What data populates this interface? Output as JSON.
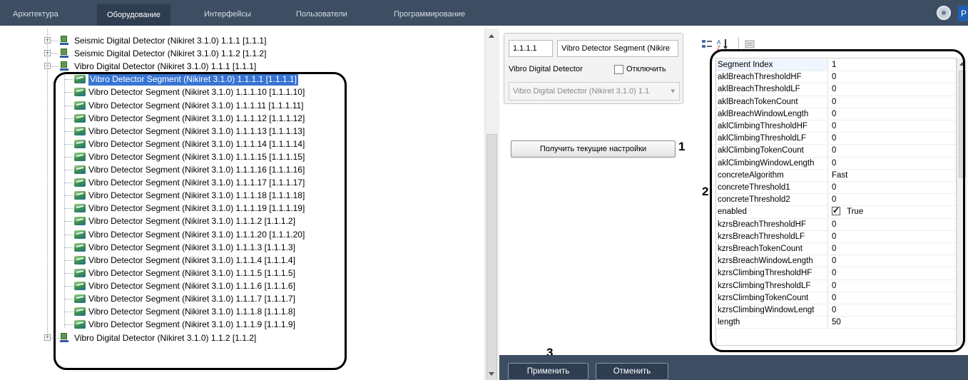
{
  "nav": {
    "tabs": [
      "Архитектура",
      "Оборудование",
      "Интерфейсы",
      "Пользователи",
      "Программирование"
    ],
    "active_tab": "Оборудование",
    "lang_badge": "P"
  },
  "tree": {
    "device_rows": [
      "Seismic Digital Detector (Nikiret 3.1.0) 1.1.1 [1.1.1]",
      "Seismic Digital Detector (Nikiret 3.1.0) 1.1.2 [1.1.2]",
      "Vibro Digital Detector (Nikiret 3.1.0) 1.1.1 [1.1.1]"
    ],
    "segments": [
      "Vibro Detector Segment (Nikiret 3.1.0) 1.1.1.1 [1.1.1.1]",
      "Vibro Detector Segment (Nikiret 3.1.0) 1.1.1.10 [1.1.1.10]",
      "Vibro Detector Segment (Nikiret 3.1.0) 1.1.1.11 [1.1.1.11]",
      "Vibro Detector Segment (Nikiret 3.1.0) 1.1.1.12 [1.1.1.12]",
      "Vibro Detector Segment (Nikiret 3.1.0) 1.1.1.13 [1.1.1.13]",
      "Vibro Detector Segment (Nikiret 3.1.0) 1.1.1.14 [1.1.1.14]",
      "Vibro Detector Segment (Nikiret 3.1.0) 1.1.1.15 [1.1.1.15]",
      "Vibro Detector Segment (Nikiret 3.1.0) 1.1.1.16 [1.1.1.16]",
      "Vibro Detector Segment (Nikiret 3.1.0) 1.1.1.17 [1.1.1.17]",
      "Vibro Detector Segment (Nikiret 3.1.0) 1.1.1.18 [1.1.1.18]",
      "Vibro Detector Segment (Nikiret 3.1.0) 1.1.1.19 [1.1.1.19]",
      "Vibro Detector Segment (Nikiret 3.1.0) 1.1.1.2 [1.1.1.2]",
      "Vibro Detector Segment (Nikiret 3.1.0) 1.1.1.20 [1.1.1.20]",
      "Vibro Detector Segment (Nikiret 3.1.0) 1.1.1.3 [1.1.1.3]",
      "Vibro Detector Segment (Nikiret 3.1.0) 1.1.1.4 [1.1.1.4]",
      "Vibro Detector Segment (Nikiret 3.1.0) 1.1.1.5 [1.1.1.5]",
      "Vibro Detector Segment (Nikiret 3.1.0) 1.1.1.6 [1.1.1.6]",
      "Vibro Detector Segment (Nikiret 3.1.0) 1.1.1.7 [1.1.1.7]",
      "Vibro Detector Segment (Nikiret 3.1.0) 1.1.1.8 [1.1.1.8]",
      "Vibro Detector Segment (Nikiret 3.1.0) 1.1.1.9 [1.1.1.9]"
    ],
    "last_row": "Vibro Digital Detector (Nikiret 3.1.0) 1.1.2 [1.1.2]"
  },
  "card": {
    "id_value": "1.1.1.1",
    "name_value": "Vibro Detector Segment (Nikire",
    "parent_label": "Vibro Digital Detector",
    "disable_label": "Отключить",
    "parent_combo": "Vibro Digital Detector (Nikiret 3.1.0) 1.1"
  },
  "get_settings_button": "Получить текущие настройки",
  "callouts": {
    "one": "1",
    "two": "2",
    "three": "3"
  },
  "properties": [
    {
      "name": "Segment Index",
      "value": "1"
    },
    {
      "name": "aklBreachThresholdHF",
      "value": "0"
    },
    {
      "name": "aklBreachThresholdLF",
      "value": "0"
    },
    {
      "name": "aklBreachTokenCount",
      "value": "0"
    },
    {
      "name": "aklBreachWindowLength",
      "value": "0"
    },
    {
      "name": "aklClimbingThresholdHF",
      "value": "0"
    },
    {
      "name": "aklClimbingThresholdLF",
      "value": "0"
    },
    {
      "name": "aklClimbingTokenCount",
      "value": "0"
    },
    {
      "name": "aklClimbingWindowLength",
      "value": "0"
    },
    {
      "name": "concreteAlgorithm",
      "value": "Fast"
    },
    {
      "name": "concreteThreshold1",
      "value": "0"
    },
    {
      "name": "concreteThreshold2",
      "value": "0"
    },
    {
      "name": "enabled",
      "value": "True"
    },
    {
      "name": "kzrsBreachThresholdHF",
      "value": "0"
    },
    {
      "name": "kzrsBreachThresholdLF",
      "value": "0"
    },
    {
      "name": "kzrsBreachTokenCount",
      "value": "0"
    },
    {
      "name": "kzrsBreachWindowLength",
      "value": "0"
    },
    {
      "name": "kzrsClimbingThresholdHF",
      "value": "0"
    },
    {
      "name": "kzrsClimbingThresholdLF",
      "value": "0"
    },
    {
      "name": "kzrsClimbingTokenCount",
      "value": "0"
    },
    {
      "name": "kzrsClimbingWindowLengt",
      "value": "0"
    },
    {
      "name": "length",
      "value": "50"
    }
  ],
  "footer": {
    "apply": "Применить",
    "cancel": "Отменить"
  },
  "colors": {
    "nav_bg": "#3d4e63",
    "selection": "#3774d4",
    "annotation": "#000000"
  }
}
